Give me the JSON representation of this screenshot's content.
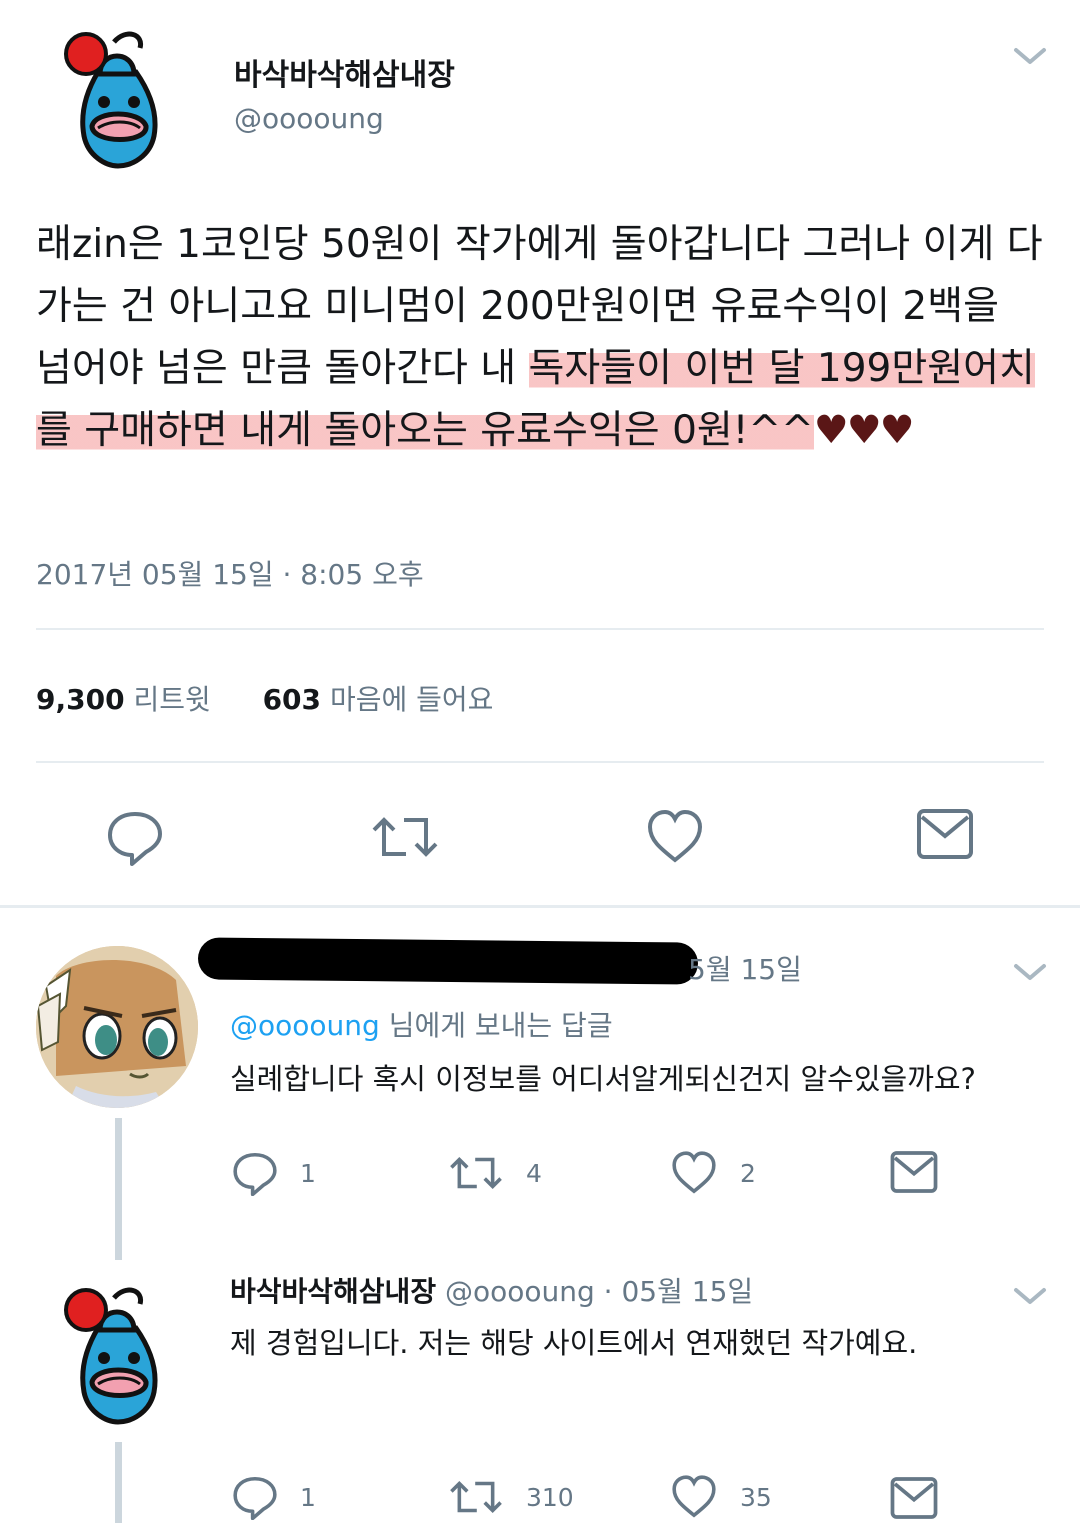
{
  "main_tweet": {
    "display_name": "바삭바삭해삼내장",
    "handle": "@ooooung",
    "text_plain": "래zin은 1코인당 50원이 작가에게 돌아갑니다 그러나 이게 다 가는 건 아니고요 미니멈이 200만원이면 유료수익이 2백을 넘어야 넘은 만큼 돌아간다 내 ",
    "text_highlight": "독자들이 이번 달 199만원어치를 구매하면 내게 돌아오는 유료수익은 0원!^^",
    "hearts": "♥♥♥",
    "timestamp": "2017년 05월 15일 · 8:05 오후",
    "retweets_count": "9,300",
    "retweets_label": "리트윗",
    "likes_count": "603",
    "likes_label": "마음에 들어요"
  },
  "reply_1": {
    "date": "5월 15일",
    "reply_to_prefix": "",
    "reply_to_handle": "@ooooung",
    "reply_to_suffix": " 님에게 보내는 답글",
    "text": "실례합니다 혹시 이정보를 어디서알게되신건지 알수있을까요?",
    "reply_count": "1",
    "retweet_count": "4",
    "like_count": "2"
  },
  "reply_2": {
    "display_name": "바삭바삭해삼내장",
    "meta": " @ooooung · 05월 15일",
    "text": "제 경험입니다. 저는 해당 사이트에서 연재했던 작가예요.",
    "reply_count": "1",
    "retweet_count": "310",
    "like_count": "35"
  },
  "icons": [
    "reply-icon",
    "retweet-icon",
    "like-icon",
    "message-icon",
    "chevron-down-icon",
    "avatar-mascot",
    "avatar-anime"
  ],
  "colors": {
    "text": "#14171a",
    "secondary": "#657786",
    "link": "#1da1f2",
    "highlight": "#f49696",
    "divider": "#e6ecf0"
  }
}
